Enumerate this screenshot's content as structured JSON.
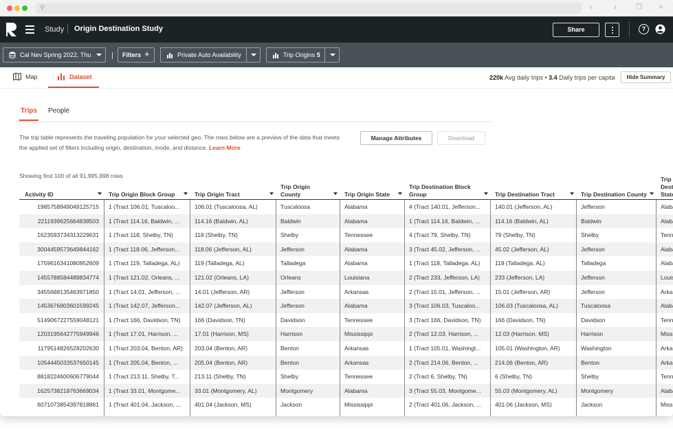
{
  "app": {
    "crumb_root": "Study",
    "crumb_title": "Origin Destination Study",
    "share_label": "Share",
    "help_label": "?"
  },
  "filters": {
    "dataset": "Cal Nev Spring 2022, Thu",
    "filters_label": "Filters",
    "availability": "Private Auto Availability",
    "trip_origins_label": "Trip Origins",
    "trip_origins_count": "5"
  },
  "view_tabs": {
    "map": "Map",
    "dataset": "Dataset"
  },
  "summary": {
    "avg_value": "220k",
    "avg_label": "Avg daily trips",
    "sep": "•",
    "capita_value": "3.4",
    "capita_label": "Daily trips per capita",
    "hide_label": "Hide Summary"
  },
  "content": {
    "tab_trips": "Trips",
    "tab_people": "People",
    "description": "The trip table represents the traveling population for your selected geo. The rows below are a preview of the data that meets the applied set of filters including origin, destination, mode, and distance.",
    "learn_more": "Learn More",
    "manage_label": "Manage Attributes",
    "download_label": "Download",
    "showing": "Showing first 100 of all 91,995,998 rows"
  },
  "table": {
    "headers": [
      "Activity ID",
      "Trip Origin Block Group",
      "Trip Origin Tract",
      "Trip Origin County",
      "Trip Origin State",
      "Trip Destination Block Group",
      "Trip Destination Tract",
      "Trip Destination County",
      "Trip Destination State"
    ],
    "rows": [
      [
        "1985758949049125715",
        "1 (Tract 106.01, Tuscaloo...",
        "106.01 (Tuscaloosa, AL)",
        "Tuscaloosa",
        "Alabama",
        "4 (Tract 140.01, Jefferson...",
        "140.01 (Jefferson, AL)",
        "Jefferson",
        "Alabama"
      ],
      [
        "2211939625664838503",
        "1 (Tract 114.16, Baldwin, ...",
        "114.16 (Baldwin, AL)",
        "Baldwin",
        "Alabama",
        "1 (Tract 114.16, Baldwin, ...",
        "114.16 (Baldwin, AL)",
        "Baldwin",
        "Alabama"
      ],
      [
        "1623593734313229631",
        "1 (Tract 118, Shelby, TN)",
        "118 (Shelby, TN)",
        "Shelby",
        "Tennessee",
        "4 (Tract 79, Shelby, TN)",
        "79 (Shelby, TN)",
        "Shelby",
        "Tennessee"
      ],
      [
        "3004459573649844162",
        "1 (Tract 118.06, Jefferson...",
        "118.06 (Jefferson, AL)",
        "Jefferson",
        "Alabama",
        "3 (Tract 45.02, Jefferson, ...",
        "45.02 (Jefferson, AL)",
        "Jefferson",
        "Alabama"
      ],
      [
        "1759616341080952609",
        "1 (Tract 119, Talladega, AL)",
        "119 (Talladega, AL)",
        "Talladega",
        "Alabama",
        "1 (Tract 118, Talladega, AL)",
        "118 (Talladega, AL)",
        "Talladega",
        "Alabama"
      ],
      [
        "1455788584489834774",
        "1 (Tract 121.02, Orleans, ...",
        "121.02 (Orleans, LA)",
        "Orleans",
        "Louisiana",
        "2 (Tract 233, Jefferson, LA)",
        "233 (Jefferson, LA)",
        "Jefferson",
        "Louisiana"
      ],
      [
        "3455688135463971850",
        "1 (Tract 14.01, Jefferson, ...",
        "14.01 (Jefferson, AR)",
        "Jefferson",
        "Arkansas",
        "2 (Tract 15.01, Jefferson, ...",
        "15.01 (Jefferson, AR)",
        "Jefferson",
        "Arkansas"
      ],
      [
        "1453676903601599245",
        "1 (Tract 142.07, Jefferson...",
        "142.07 (Jefferson, AL)",
        "Jefferson",
        "Alabama",
        "3 (Tract 106.03, Tuscaloo...",
        "106.03 (Tuscaloosa, AL)",
        "Tuscaloosa",
        "Alabama"
      ],
      [
        "5149067227559048121",
        "1 (Tract 166, Davidson, TN)",
        "166 (Davidson, TN)",
        "Davidson",
        "Tennessee",
        "3 (Tract 166, Davidson, TN)",
        "166 (Davidson, TN)",
        "Davidson",
        "Tennessee"
      ],
      [
        "1203195642775949946",
        "1 (Tract 17.01, Harrison, ...",
        "17.01 (Harrison, MS)",
        "Harrison",
        "Mississippi",
        "2 (Tract 12.03, Harrison, ...",
        "12.03 (Harrison, MS)",
        "Harrison",
        "Mississippi"
      ],
      [
        "1179514826528202630",
        "1 (Tract 203.04, Benton, AR)",
        "203.04 (Benton, AR)",
        "Benton",
        "Arkansas",
        "1 (Tract 105.01, Washingt...",
        "105.01 (Washington, AR)",
        "Washington",
        "Arkansas"
      ],
      [
        "1054445033537650145",
        "1 (Tract 205.04, Benton, ...",
        "205.04 (Benton, AR)",
        "Benton",
        "Arkansas",
        "2 (Tract 214.06, Benton, ...",
        "214.06 (Benton, AR)",
        "Benton",
        "Arkansas"
      ],
      [
        "8818224600606779044",
        "1 (Tract 213.11, Shelby, T...",
        "213.11 (Shelby, TN)",
        "Shelby",
        "Tennessee",
        "2 (Tract 6, Shelby, TN)",
        "6 (Shelby, TN)",
        "Shelby",
        "Tennessee"
      ],
      [
        "1625738218763669034",
        "1 (Tract 33.01, Montgome...",
        "33.01 (Montgomery, AL)",
        "Montgomery",
        "Alabama",
        "3 (Tract 55.03, Montgome...",
        "55.03 (Montgomery, AL)",
        "Montgomery",
        "Alabama"
      ],
      [
        "6071073854397818861",
        "1 (Tract 401.04, Jackson, ...",
        "401.04 (Jackson, MS)",
        "Jackson",
        "Mississippi",
        "2 (Tract 401.06, Jackson, ...",
        "401.06 (Jackson, MS)",
        "Jackson",
        "Mississippi"
      ]
    ]
  },
  "colors": {
    "accent": "#e04e2c",
    "header_bg": "#1c2326",
    "filter_bg": "#495257",
    "row_alt": "#f1f1f1"
  }
}
